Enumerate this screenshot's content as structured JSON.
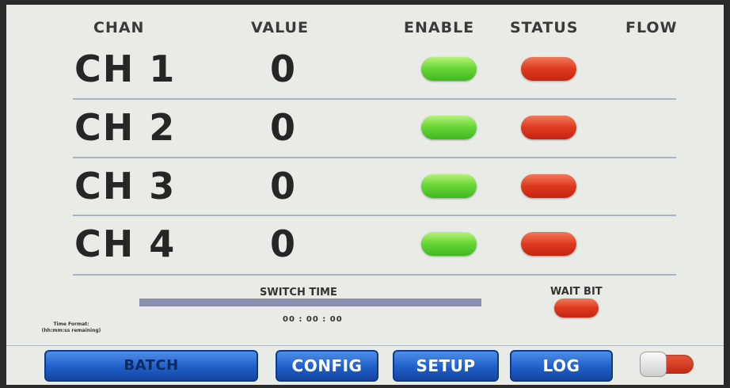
{
  "headers": {
    "chan": "CHAN",
    "value": "VALUE",
    "enable": "ENABLE",
    "status": "STATUS",
    "flow": "FLOW"
  },
  "channels": [
    {
      "name": "CH 1",
      "value": "0",
      "enable_color": "#5cc832",
      "status_color": "#d93a22"
    },
    {
      "name": "CH 2",
      "value": "0",
      "enable_color": "#5cc832",
      "status_color": "#d93a22"
    },
    {
      "name": "CH 3",
      "value": "0",
      "enable_color": "#5cc832",
      "status_color": "#d93a22"
    },
    {
      "name": "CH 4",
      "value": "0",
      "enable_color": "#5cc832",
      "status_color": "#d93a22"
    }
  ],
  "switch": {
    "label": "SWITCH TIME",
    "time": "00 : 00 : 00",
    "progress": 1.0
  },
  "wait_bit": {
    "label": "WAIT BIT",
    "color": "#d93a22"
  },
  "time_format": {
    "line1": "Time Format:",
    "line2": "(hh:mm:ss remaining)"
  },
  "nav": {
    "batch": "BATCH",
    "config": "CONFIG",
    "setup": "SETUP",
    "log": "LOG"
  },
  "toggle": {
    "state": "off",
    "color": "#d93a22"
  }
}
